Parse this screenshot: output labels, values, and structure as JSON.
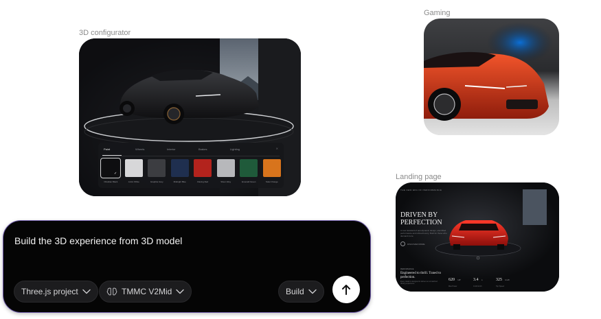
{
  "cards": {
    "configurator": {
      "label": "3D configurator",
      "tabs": [
        "Paint",
        "Wheels",
        "Interior",
        "Brakes",
        "Lighting"
      ],
      "active_tab": "Paint",
      "swatches": [
        {
          "name": "Obsidian Black",
          "color": "#0e0e10",
          "selected": true
        },
        {
          "name": "Arctic White",
          "color": "#d7d7d9",
          "selected": false
        },
        {
          "name": "Graphite Grey",
          "color": "#3c3d41",
          "selected": false
        },
        {
          "name": "Midnight Blue",
          "color": "#1f2f4f",
          "selected": false
        },
        {
          "name": "Racing Red",
          "color": "#b3231d",
          "selected": false
        },
        {
          "name": "Silver Alloy",
          "color": "#b7b8bb",
          "selected": false
        },
        {
          "name": "Emerald Green",
          "color": "#1f5a3a",
          "selected": false
        },
        {
          "name": "Solar Orange",
          "color": "#d8741c",
          "selected": false
        }
      ]
    },
    "gaming": {
      "label": "Gaming"
    },
    "landing": {
      "label": "Landing page",
      "kicker": "THE NEW ERA OF PERFORMANCE",
      "headline": "DRIVEN BY PERFECTION",
      "body": "A new standard of aerodynamic design, electrified performance and refined luxury. Built for those who demand more.",
      "cta": "DISCOVER MORE",
      "bottom_kicker": "PERFORMANCE",
      "bottom_title": "Engineered to thrill. Tuned to perfection.",
      "bottom_body": "Every detail is designed to deliver an unmatched driving experience.",
      "stats": [
        {
          "value": "620",
          "unit": "HP",
          "label": "Max Power"
        },
        {
          "value": "3.4",
          "unit": "s",
          "label": "0-100 km/h"
        },
        {
          "value": "325",
          "unit": "km/h",
          "label": "Top Speed"
        }
      ]
    }
  },
  "prompt": {
    "text": "Build the 3D experience from 3D model",
    "project_select": "Three.js project",
    "model_select": "TMMC V2Mid",
    "mode_select": "Build"
  }
}
